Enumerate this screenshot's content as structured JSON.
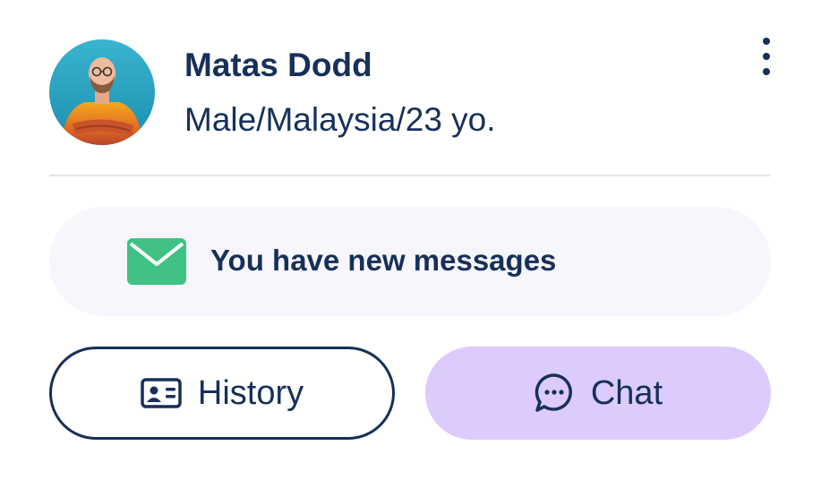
{
  "profile": {
    "name": "Matas Dodd",
    "details": "Male/Malaysia/23 yo."
  },
  "notification": {
    "text": "You have new messages",
    "icon": "envelope-icon",
    "icon_color": "#3fc283"
  },
  "actions": {
    "history_label": "History",
    "history_icon": "id-card-icon",
    "chat_label": "Chat",
    "chat_icon": "chat-bubble-icon"
  },
  "colors": {
    "text": "#16305a",
    "banner_bg": "#f8f6fd",
    "chat_bg": "#dccbfc"
  }
}
